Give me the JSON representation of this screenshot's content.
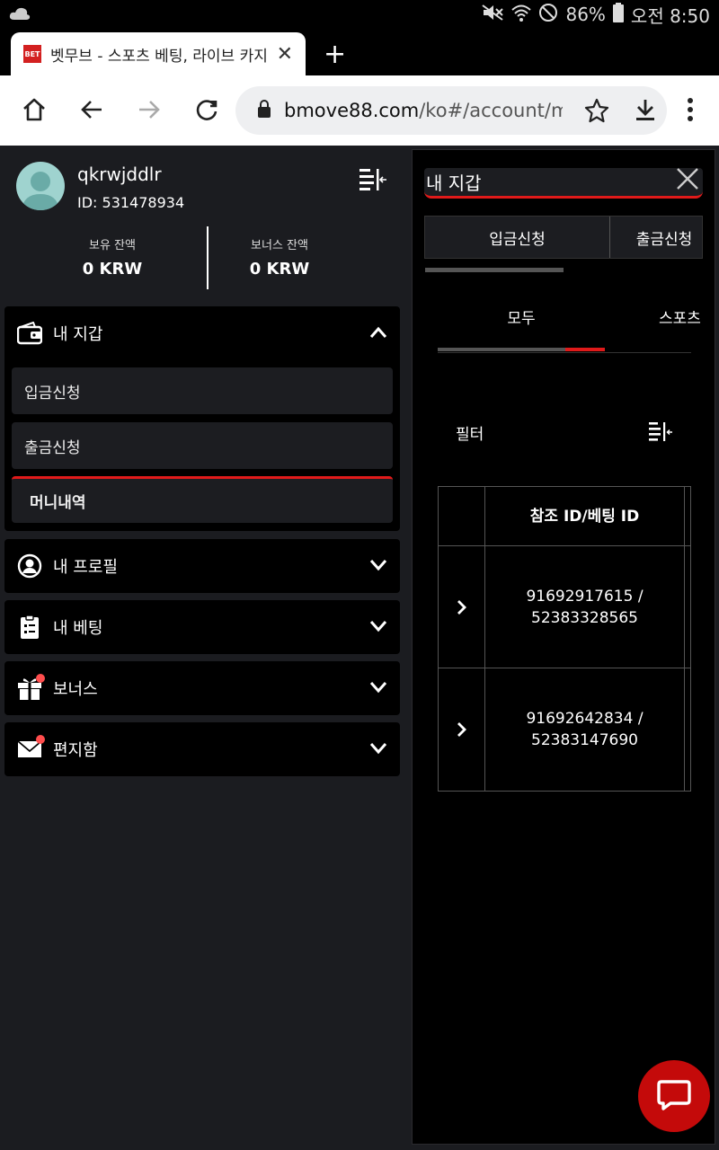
{
  "status_bar": {
    "battery": "86%",
    "time": "오전 8:50"
  },
  "browser": {
    "tab_title": "벳무브 - 스포츠 베팅, 라이브 카지노",
    "favicon_text": "BET",
    "url_host": "bmove88.com",
    "url_path": "/ko#/account/my-wallet"
  },
  "profile": {
    "username": "qkrwjddlr",
    "id_label": "ID: 531478934",
    "balance_label": "보유 잔액",
    "balance_value": "0 KRW",
    "bonus_label": "보너스 잔액",
    "bonus_value": "0 KRW"
  },
  "menu": {
    "wallet": {
      "label": "내 지갑",
      "items": [
        "입금신청",
        "출금신청",
        "머니내역"
      ]
    },
    "profile": "내 프로필",
    "betting": "내 베팅",
    "bonus": "보너스",
    "inbox": "편지함"
  },
  "panel": {
    "title": "내 지갑",
    "tabs": [
      "입금신청",
      "출금신청"
    ],
    "subtabs": [
      "모두",
      "스포츠"
    ],
    "filter_label": "필터",
    "table_header": "참조 ID/베팅 ID",
    "rows": [
      {
        "line1": "91692917615 /",
        "line2": "52383328565"
      },
      {
        "line1": "91692642834 /",
        "line2": "52383147690"
      }
    ]
  },
  "colors": {
    "accent": "#e01a1a",
    "bg": "#1b1c20",
    "card": "#000000",
    "chat": "#c40a0a"
  }
}
